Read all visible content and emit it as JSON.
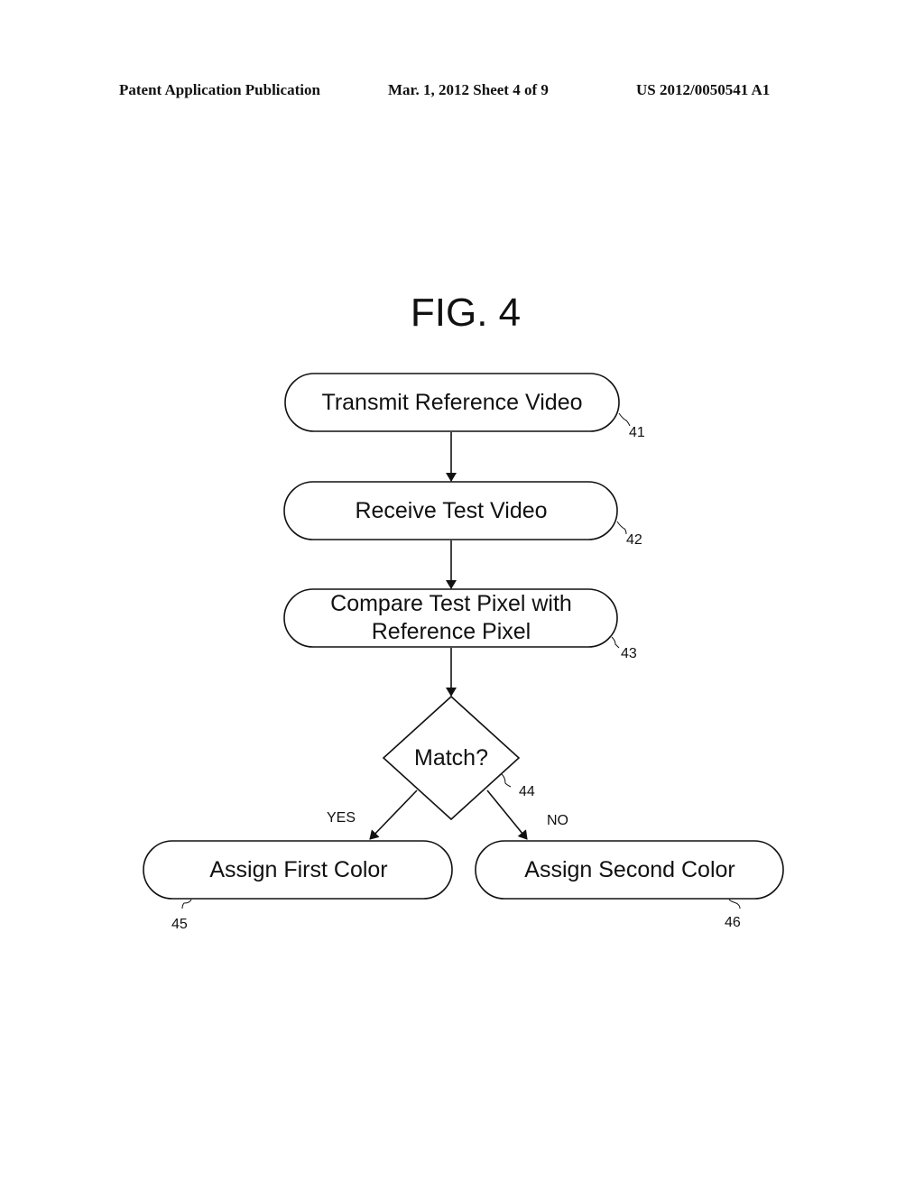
{
  "header": {
    "left": "Patent Application Publication",
    "middle": "Mar. 1, 2012   Sheet 4 of 9",
    "right": "US 2012/0050541 A1"
  },
  "figure": {
    "title": "FIG. 4",
    "nodes": [
      {
        "id": "41",
        "shape": "terminal",
        "lines": [
          "Transmit Reference Video"
        ],
        "ref": "41"
      },
      {
        "id": "42",
        "shape": "terminal",
        "lines": [
          "Receive Test Video"
        ],
        "ref": "42"
      },
      {
        "id": "43",
        "shape": "terminal",
        "lines": [
          "Compare Test Pixel with",
          "Reference Pixel"
        ],
        "ref": "43"
      },
      {
        "id": "44",
        "shape": "decision",
        "lines": [
          "Match?"
        ],
        "ref": "44"
      },
      {
        "id": "45",
        "shape": "terminal",
        "lines": [
          "Assign First Color"
        ],
        "ref": "45"
      },
      {
        "id": "46",
        "shape": "terminal",
        "lines": [
          "Assign Second Color"
        ],
        "ref": "46"
      }
    ],
    "edges": [
      {
        "from": "41",
        "to": "42",
        "label": ""
      },
      {
        "from": "42",
        "to": "43",
        "label": ""
      },
      {
        "from": "43",
        "to": "44",
        "label": ""
      },
      {
        "from": "44",
        "to": "45",
        "label": "YES"
      },
      {
        "from": "44",
        "to": "46",
        "label": "NO"
      }
    ]
  }
}
